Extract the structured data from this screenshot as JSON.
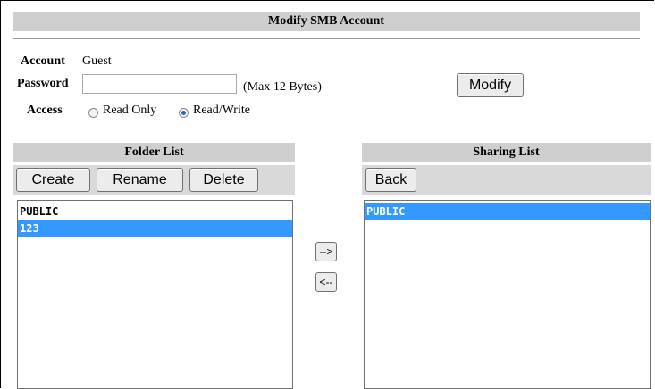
{
  "title": "Modify SMB Account",
  "account": {
    "label": "Account",
    "value": "Guest"
  },
  "password": {
    "label": "Password",
    "value": "",
    "hint": "(Max 12 Bytes)"
  },
  "access": {
    "label": "Access",
    "options": [
      "Read Only",
      "Read/Write"
    ],
    "selected": "Read/Write"
  },
  "modify_button": "Modify",
  "folder_list": {
    "title": "Folder List",
    "buttons": {
      "create": "Create",
      "rename": "Rename",
      "delete": "Delete"
    },
    "items": [
      "PUBLIC",
      "123"
    ],
    "selected": "123"
  },
  "sharing_list": {
    "title": "Sharing List",
    "buttons": {
      "back": "Back"
    },
    "items": [
      "PUBLIC"
    ],
    "selected": "PUBLIC"
  },
  "move_buttons": {
    "add": "-->",
    "remove": "<--"
  },
  "colors": {
    "section_bg": "#cfcfcf",
    "toolbar_bg": "#d9d9d9",
    "selection": "#3399ff"
  }
}
